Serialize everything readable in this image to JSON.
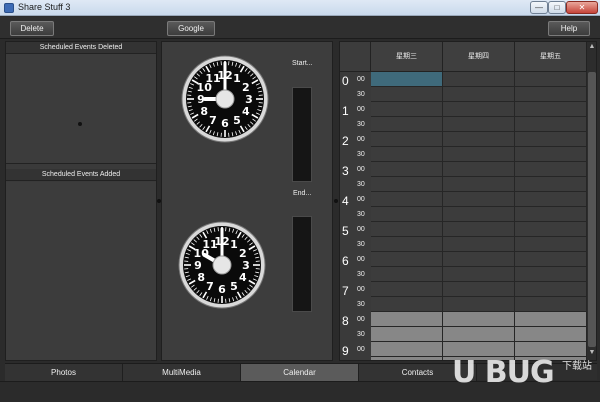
{
  "window": {
    "title": "Share Stuff 3",
    "controls": {
      "minimize": "—",
      "maximize": "□",
      "close": "✕"
    }
  },
  "toolbar": {
    "delete_label": "Delete",
    "google_label": "Google",
    "help_label": "Help"
  },
  "left_panel": {
    "deleted_header": "Scheduled Events Deleted",
    "added_header": "Scheduled Events  Added"
  },
  "middle_panel": {
    "start_label": "Start...",
    "end_label": "End...",
    "start_clock": {
      "hour": 9,
      "minute": 0
    },
    "end_clock": {
      "hour": 10,
      "minute": 0
    }
  },
  "calendar": {
    "days": [
      "星期三",
      "星期四",
      "星期五"
    ],
    "hours": [
      "0",
      "1",
      "2",
      "3",
      "4",
      "5",
      "6",
      "7",
      "8",
      "9"
    ],
    "minutes": [
      "00",
      "30"
    ],
    "selected_slot": {
      "day": 0,
      "hour": 0,
      "minute": 0
    },
    "shaded_from_hour": 8,
    "colors": {
      "selected": "#3f6a7b",
      "shaded": "#878787"
    }
  },
  "tabs": [
    {
      "label": "Photos",
      "active": false
    },
    {
      "label": "MultiMedia",
      "active": false
    },
    {
      "label": "Calendar",
      "active": true
    },
    {
      "label": "Contacts",
      "active": false
    }
  ],
  "watermark": {
    "brand": "U BUG",
    "tagline": "下载站"
  }
}
